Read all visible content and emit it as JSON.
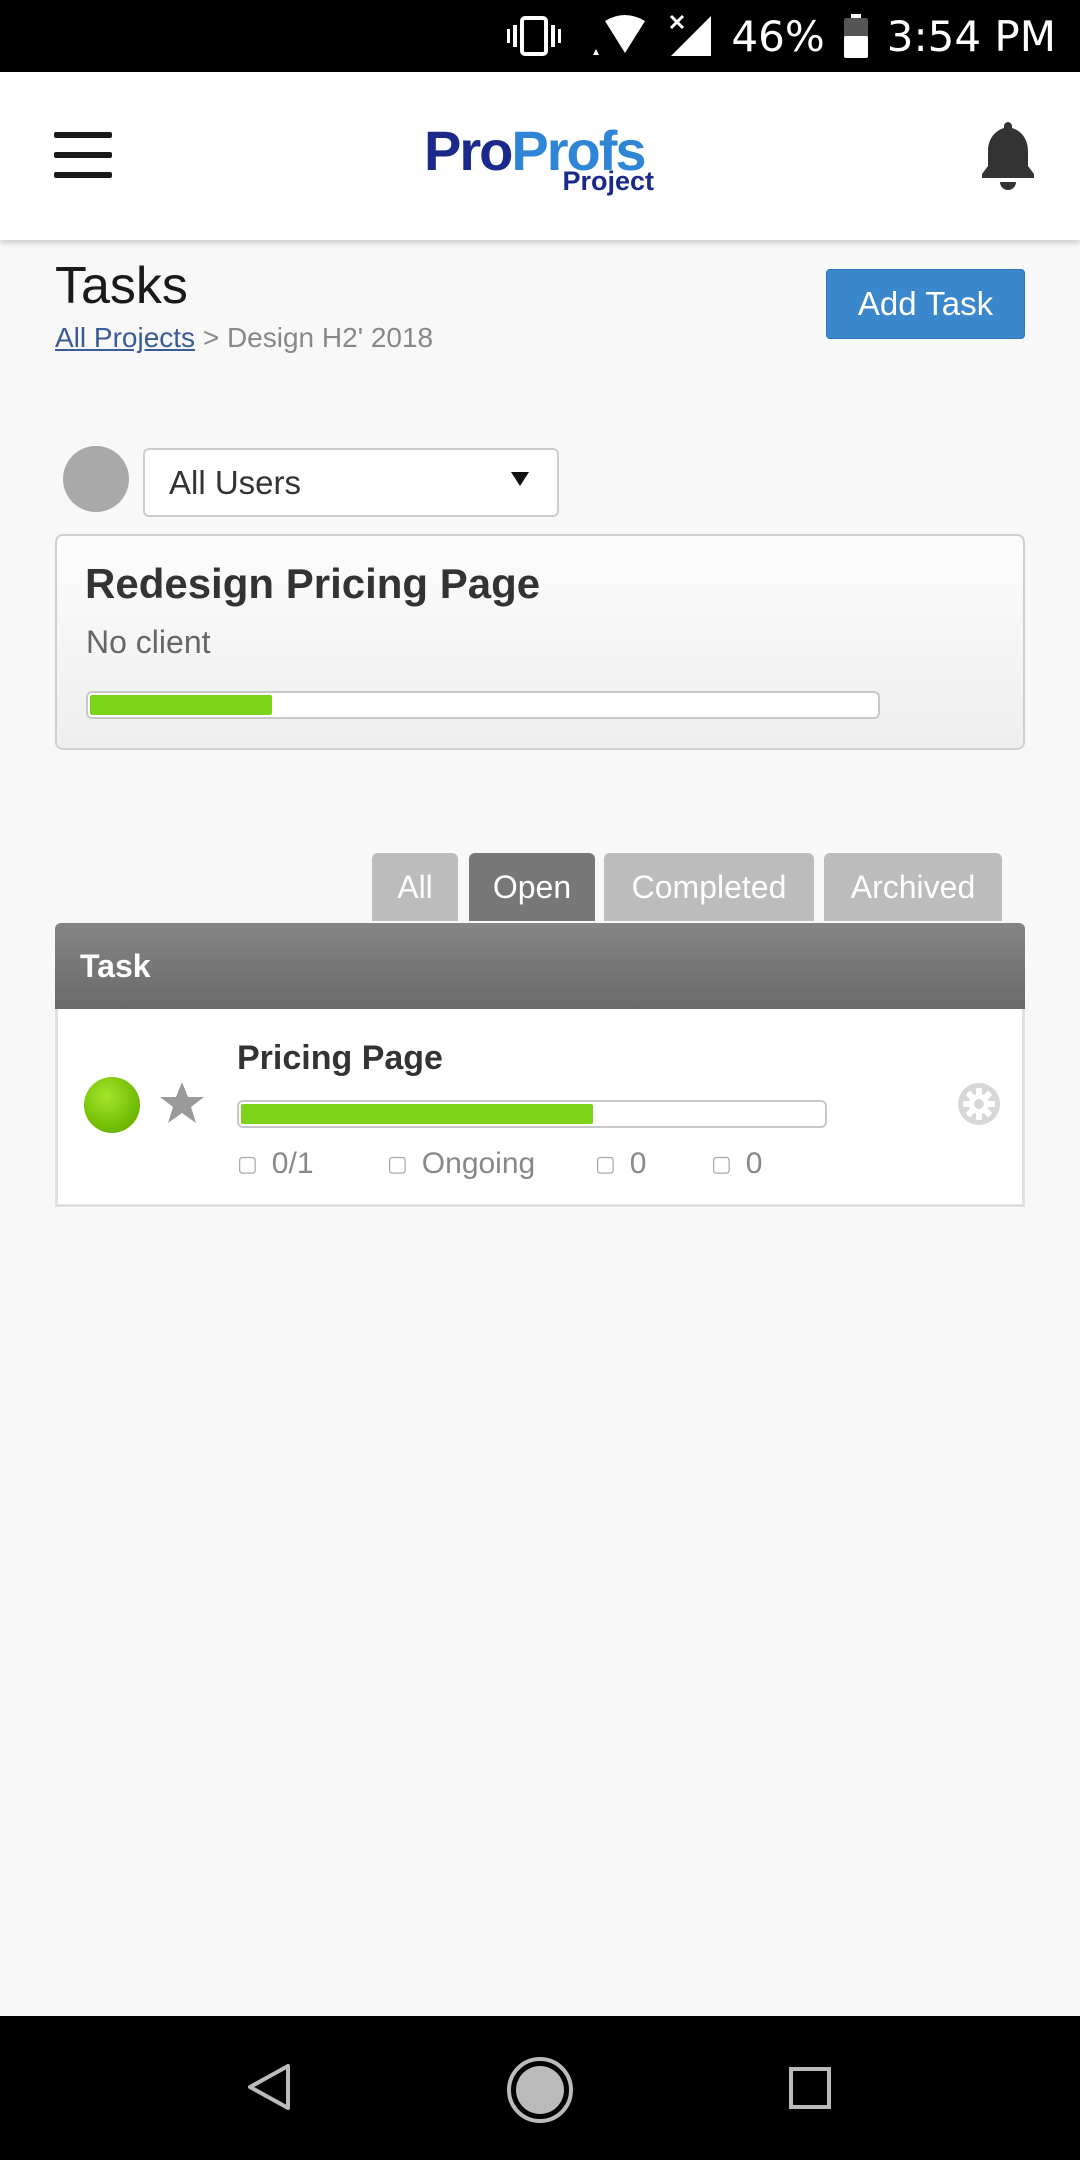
{
  "status_bar": {
    "battery": "46%",
    "time": "3:54 PM",
    "icons": [
      "vibrate-icon",
      "wifi-icon",
      "signal-icon",
      "battery-icon"
    ]
  },
  "header": {
    "logo_main_1": "Pro",
    "logo_main_2": "Profs",
    "logo_sub": "Project",
    "icons": [
      "menu-icon",
      "notification-bell-icon"
    ]
  },
  "page": {
    "title": "Tasks",
    "breadcrumb_link": "All Projects",
    "breadcrumb_rest": " > Design H2' 2018",
    "add_task_label": "Add Task"
  },
  "filter": {
    "avatar_glyph": "",
    "selected_user": "All Users"
  },
  "project": {
    "name": "Redesign Pricing Page",
    "client": "No client",
    "progress_fraction": 0.23
  },
  "tabs": [
    {
      "label": "All",
      "active": false
    },
    {
      "label": "Open",
      "active": true
    },
    {
      "label": "Completed",
      "active": false
    },
    {
      "label": "Archived",
      "active": false
    }
  ],
  "table": {
    "header": "Task",
    "rows": [
      {
        "name": "Pricing Page",
        "progress_fraction": 0.6,
        "subtasks": "0/1",
        "status": "Ongoing",
        "comments": "0",
        "attachments": "0",
        "status_color": "#7dd319"
      }
    ]
  },
  "colors": {
    "accent": "#3b87cc",
    "progress": "#7dd319",
    "tab_active": "#777777",
    "tab_inactive": "#bcbcbc"
  },
  "nav_bar": {
    "icons": [
      "back-icon",
      "home-icon",
      "recents-icon"
    ]
  }
}
